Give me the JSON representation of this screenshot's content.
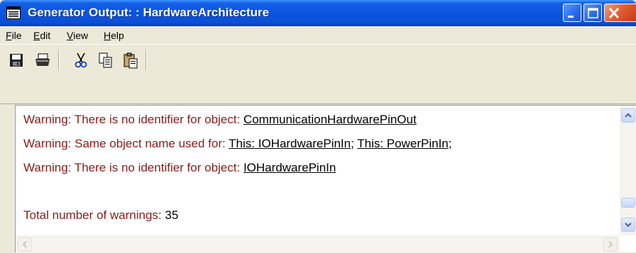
{
  "window": {
    "title": "Generator Output: : HardwareArchitecture",
    "icon": "document-list-icon"
  },
  "controls": {
    "minimize_icon": "minimize-icon",
    "maximize_icon": "maximize-icon",
    "close_icon": "close-icon"
  },
  "menu": {
    "items": [
      {
        "mnemonic": "F",
        "rest": "ile"
      },
      {
        "mnemonic": "E",
        "rest": "dit"
      },
      {
        "mnemonic": "V",
        "rest": "iew"
      },
      {
        "mnemonic": "H",
        "rest": "elp"
      }
    ]
  },
  "toolbar": {
    "tools": [
      "save-icon",
      "print-icon",
      "cut-icon",
      "copy-icon",
      "paste-icon"
    ]
  },
  "output": {
    "line1": {
      "text": "Warning: There is no identifier for object: ",
      "link": "CommunicationHardwarePinOut"
    },
    "line2": {
      "text": "Warning: Same object name used for: ",
      "link1": "This: IOHardwarePinIn",
      "sep": "; ",
      "link2": "This: PowerPinIn",
      "end": ";"
    },
    "line3": {
      "text": "Warning: There is no identifier for object: ",
      "link": "IOHardwarePinIn"
    },
    "total": {
      "label": "Total number of warnings: ",
      "count": "35"
    }
  },
  "colors": {
    "titlebar": "#0a54e0",
    "warning_text": "#8b1a1a",
    "link_text": "#000000",
    "close_button": "#e05a30"
  }
}
